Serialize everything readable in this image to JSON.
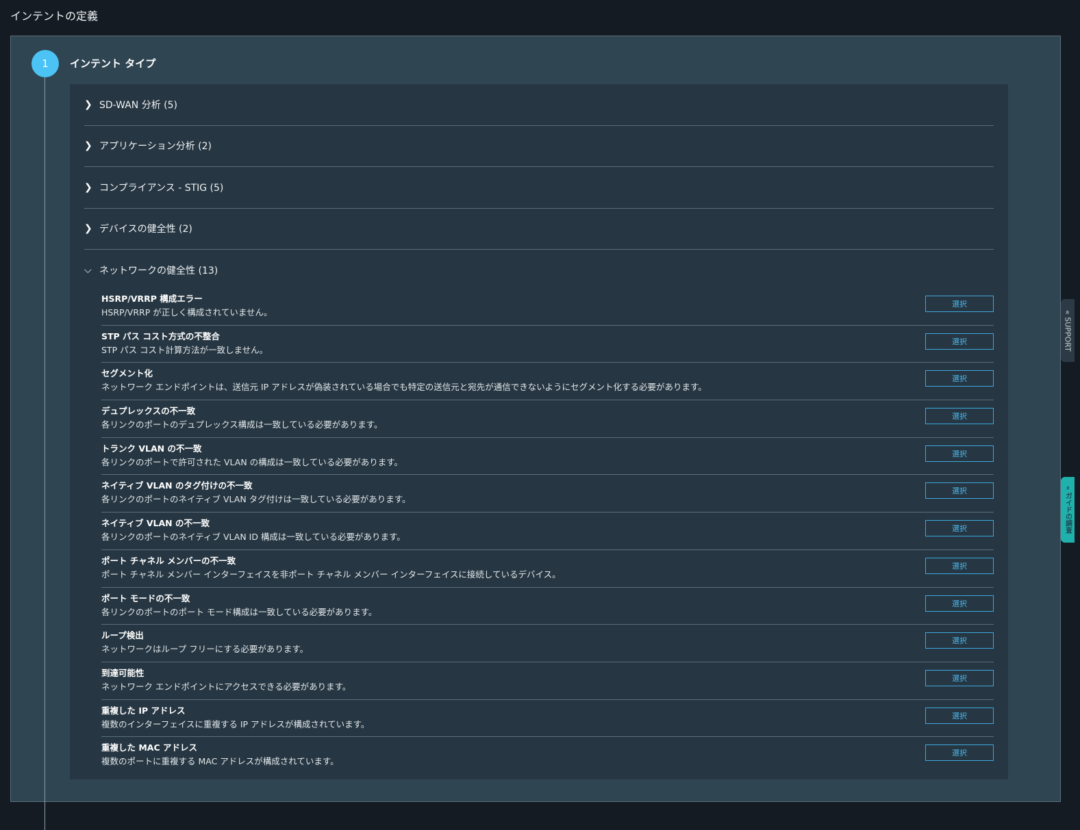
{
  "page_title": "インテントの定義",
  "step": {
    "number": "1",
    "label": "インテント タイプ"
  },
  "categories": [
    {
      "label": "SD-WAN 分析 (5)"
    },
    {
      "label": "アプリケーション分析 (2)"
    },
    {
      "label": "コンプライアンス - STIG (5)"
    },
    {
      "label": "デバイスの健全性 (2)"
    },
    {
      "label": "ネットワークの健全性 (13)"
    }
  ],
  "select_label": "選択",
  "items": [
    {
      "title": "HSRP/VRRP 構成エラー",
      "desc": "HSRP/VRRP が正しく構成されていません。"
    },
    {
      "title": "STP パス コスト方式の不整合",
      "desc": "STP パス コスト計算方法が一致しません。"
    },
    {
      "title": "セグメント化",
      "desc": "ネットワーク エンドポイントは、送信元 IP アドレスが偽装されている場合でも特定の送信元と宛先が通信できないようにセグメント化する必要があります。"
    },
    {
      "title": "デュプレックスの不一致",
      "desc": "各リンクのポートのデュプレックス構成は一致している必要があります。"
    },
    {
      "title": "トランク VLAN の不一致",
      "desc": "各リンクのポートで許可された VLAN の構成は一致している必要があります。"
    },
    {
      "title": "ネイティブ VLAN のタグ付けの不一致",
      "desc": "各リンクのポートのネイティブ VLAN タグ付けは一致している必要があります。"
    },
    {
      "title": "ネイティブ VLAN の不一致",
      "desc": "各リンクのポートのネイティブ VLAN ID 構成は一致している必要があります。"
    },
    {
      "title": "ポート チャネル メンバーの不一致",
      "desc": "ポート チャネル メンバー インターフェイスを非ポート チャネル メンバー インターフェイスに接続しているデバイス。"
    },
    {
      "title": "ポート モードの不一致",
      "desc": "各リンクのポートのポート モード構成は一致している必要があります。"
    },
    {
      "title": "ループ検出",
      "desc": "ネットワークはループ フリーにする必要があります。"
    },
    {
      "title": "到達可能性",
      "desc": "ネットワーク エンドポイントにアクセスできる必要があります。"
    },
    {
      "title": "重複した IP アドレス",
      "desc": "複数のインターフェイスに重複する IP アドレスが構成されています。"
    },
    {
      "title": "重複した MAC アドレス",
      "desc": "複数のポートに重複する MAC アドレスが構成されています。"
    }
  ],
  "side_tabs": {
    "support": "« SUPPORT",
    "guide": "« ガイドの調査"
  }
}
